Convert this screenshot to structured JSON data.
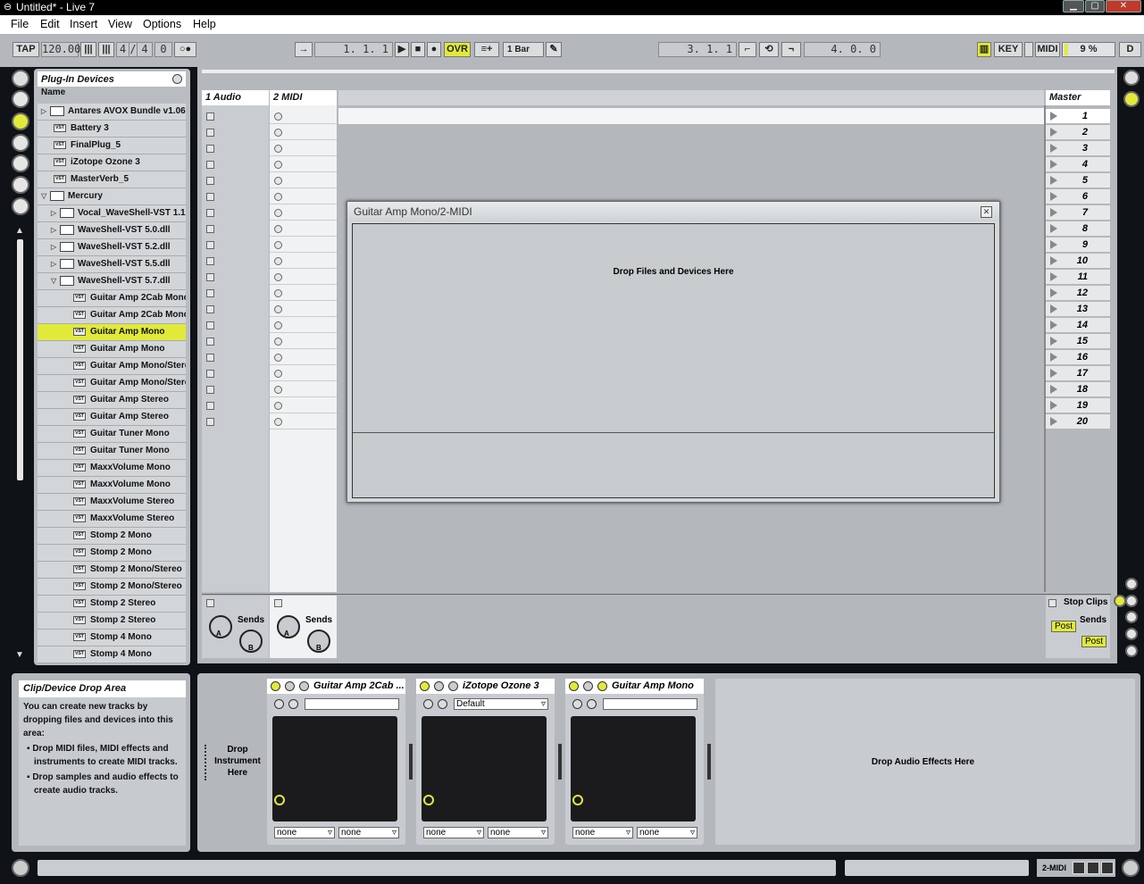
{
  "window": {
    "title": "Untitled* - Live 7"
  },
  "menu": [
    "File",
    "Edit",
    "Insert",
    "View",
    "Options",
    "Help"
  ],
  "transport": {
    "tap": "TAP",
    "tempo": "120.00",
    "sig_num": "4",
    "sig_den": "4",
    "metro_val": "0",
    "position": "1.  1.  1",
    "ovr": "OVR",
    "quantize": "1 Bar",
    "loop_start": "3.  1.  1",
    "loop_length": "4.  0.  0",
    "key": "KEY",
    "midi": "MIDI",
    "cpu": "9 %",
    "d": "D"
  },
  "browser": {
    "title": "Plug-In Devices",
    "column": "Name",
    "items": [
      {
        "label": "Antares AVOX Bundle v1.06",
        "kind": "folder",
        "depth": 0,
        "tri": "▷"
      },
      {
        "label": "Battery 3",
        "kind": "plugin",
        "depth": 0
      },
      {
        "label": "FinalPlug_5",
        "kind": "plugin",
        "depth": 0
      },
      {
        "label": "iZotope Ozone 3",
        "kind": "plugin",
        "depth": 0
      },
      {
        "label": "MasterVerb_5",
        "kind": "plugin",
        "depth": 0
      },
      {
        "label": "Mercury",
        "kind": "folder",
        "depth": 0,
        "tri": "▽"
      },
      {
        "label": "Vocal_WaveShell-VST 1.1",
        "kind": "folder",
        "depth": 1,
        "tri": "▷"
      },
      {
        "label": "WaveShell-VST 5.0.dll",
        "kind": "folder",
        "depth": 1,
        "tri": "▷"
      },
      {
        "label": "WaveShell-VST 5.2.dll",
        "kind": "folder",
        "depth": 1,
        "tri": "▷"
      },
      {
        "label": "WaveShell-VST 5.5.dll",
        "kind": "folder",
        "depth": 1,
        "tri": "▷"
      },
      {
        "label": "WaveShell-VST 5.7.dll",
        "kind": "folder",
        "depth": 1,
        "tri": "▽"
      },
      {
        "label": "Guitar Amp 2Cab Mono",
        "kind": "plugin",
        "depth": 2
      },
      {
        "label": "Guitar Amp 2Cab Mono",
        "kind": "plugin",
        "depth": 2
      },
      {
        "label": "Guitar Amp Mono",
        "kind": "plugin",
        "depth": 2,
        "selected": true
      },
      {
        "label": "Guitar Amp Mono",
        "kind": "plugin",
        "depth": 2
      },
      {
        "label": "Guitar Amp Mono/Stereo",
        "kind": "plugin",
        "depth": 2
      },
      {
        "label": "Guitar Amp Mono/Stereo",
        "kind": "plugin",
        "depth": 2
      },
      {
        "label": "Guitar Amp Stereo",
        "kind": "plugin",
        "depth": 2
      },
      {
        "label": "Guitar Amp Stereo",
        "kind": "plugin",
        "depth": 2
      },
      {
        "label": "Guitar Tuner Mono",
        "kind": "plugin",
        "depth": 2
      },
      {
        "label": "Guitar Tuner Mono",
        "kind": "plugin",
        "depth": 2
      },
      {
        "label": "MaxxVolume Mono",
        "kind": "plugin",
        "depth": 2
      },
      {
        "label": "MaxxVolume Mono",
        "kind": "plugin",
        "depth": 2
      },
      {
        "label": "MaxxVolume Stereo",
        "kind": "plugin",
        "depth": 2
      },
      {
        "label": "MaxxVolume Stereo",
        "kind": "plugin",
        "depth": 2
      },
      {
        "label": "Stomp 2 Mono",
        "kind": "plugin",
        "depth": 2
      },
      {
        "label": "Stomp 2 Mono",
        "kind": "plugin",
        "depth": 2
      },
      {
        "label": "Stomp 2 Mono/Stereo",
        "kind": "plugin",
        "depth": 2
      },
      {
        "label": "Stomp 2 Mono/Stereo",
        "kind": "plugin",
        "depth": 2
      },
      {
        "label": "Stomp 2 Stereo",
        "kind": "plugin",
        "depth": 2
      },
      {
        "label": "Stomp 2 Stereo",
        "kind": "plugin",
        "depth": 2
      },
      {
        "label": "Stomp 4 Mono",
        "kind": "plugin",
        "depth": 2
      },
      {
        "label": "Stomp 4 Mono",
        "kind": "plugin",
        "depth": 2
      }
    ]
  },
  "session": {
    "tracks": [
      {
        "name": "1 Audio"
      },
      {
        "name": "2 MIDI"
      }
    ],
    "master": "Master",
    "scenes": [
      "1",
      "2",
      "3",
      "4",
      "5",
      "6",
      "7",
      "8",
      "9",
      "10",
      "11",
      "12",
      "13",
      "14",
      "15",
      "16",
      "17",
      "18",
      "19",
      "20"
    ],
    "sends_label": "Sends",
    "send_a": "A",
    "send_b": "B",
    "stop_clips": "Stop Clips",
    "post": "Post"
  },
  "dialog": {
    "title": "Guitar Amp Mono/2-MIDI",
    "drop_text": "Drop Files and Devices Here"
  },
  "info": {
    "title": "Clip/Device Drop Area",
    "body": "You can create new tracks by dropping files and devices into this area:",
    "bullets": [
      "Drop MIDI files, MIDI effects and instruments to create MIDI tracks.",
      "Drop samples and audio effects to create audio tracks."
    ]
  },
  "device_chain": {
    "drop_instrument": "Drop Instrument Here",
    "drop_audio": "Drop Audio Effects Here",
    "devices": [
      {
        "name": "Guitar Amp 2Cab ...",
        "preset": "",
        "sel1": "none",
        "sel2": "none"
      },
      {
        "name": "iZotope Ozone 3",
        "preset": "Default",
        "sel1": "none",
        "sel2": "none"
      },
      {
        "name": "Guitar Amp Mono",
        "preset": "",
        "sel1": "none",
        "sel2": "none"
      }
    ]
  },
  "status": {
    "track": "2-MIDI"
  },
  "colors": {
    "accent": "#e1ea3a",
    "panel": "#b4b8bc",
    "background": "#0f1217"
  }
}
